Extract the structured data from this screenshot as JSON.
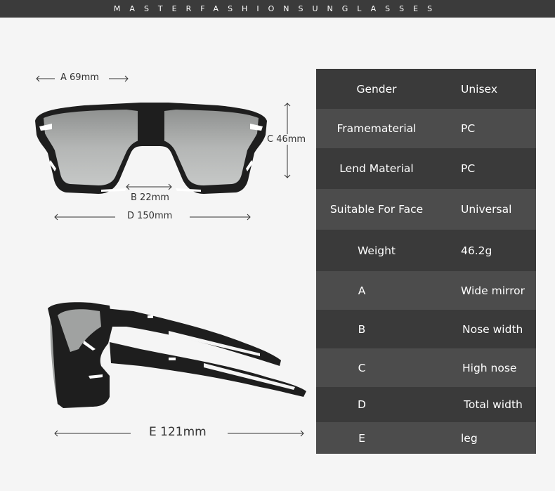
{
  "banner": {
    "text": "MASTERFASHIONSUNGLASSES"
  },
  "dimensions": {
    "a": "A 69mm",
    "b": "B 22mm",
    "c": "C 46mm",
    "d": "D 150mm",
    "e": "E 121mm"
  },
  "specs": [
    {
      "key": "Gender",
      "value": "Unisex"
    },
    {
      "key": "Framematerial",
      "value": "PC"
    },
    {
      "key": "Lend Material",
      "value": "PC"
    },
    {
      "key": "Suitable For Face",
      "value": "Universal"
    },
    {
      "key": "Weight",
      "value": "46.2g"
    },
    {
      "key": "A",
      "value": "Wide mirror"
    },
    {
      "key": "B",
      "value": "Nose width"
    },
    {
      "key": "C",
      "value": "High nose"
    },
    {
      "key": "D",
      "value": "Total width"
    },
    {
      "key": "E",
      "value": "leg"
    }
  ],
  "colors": {
    "banner": "#3b3b3b",
    "table_dark": "#3a3a3a",
    "table_light": "#4c4c4c",
    "frame": "#1e1e1e",
    "lens": "#a8aaa9"
  }
}
